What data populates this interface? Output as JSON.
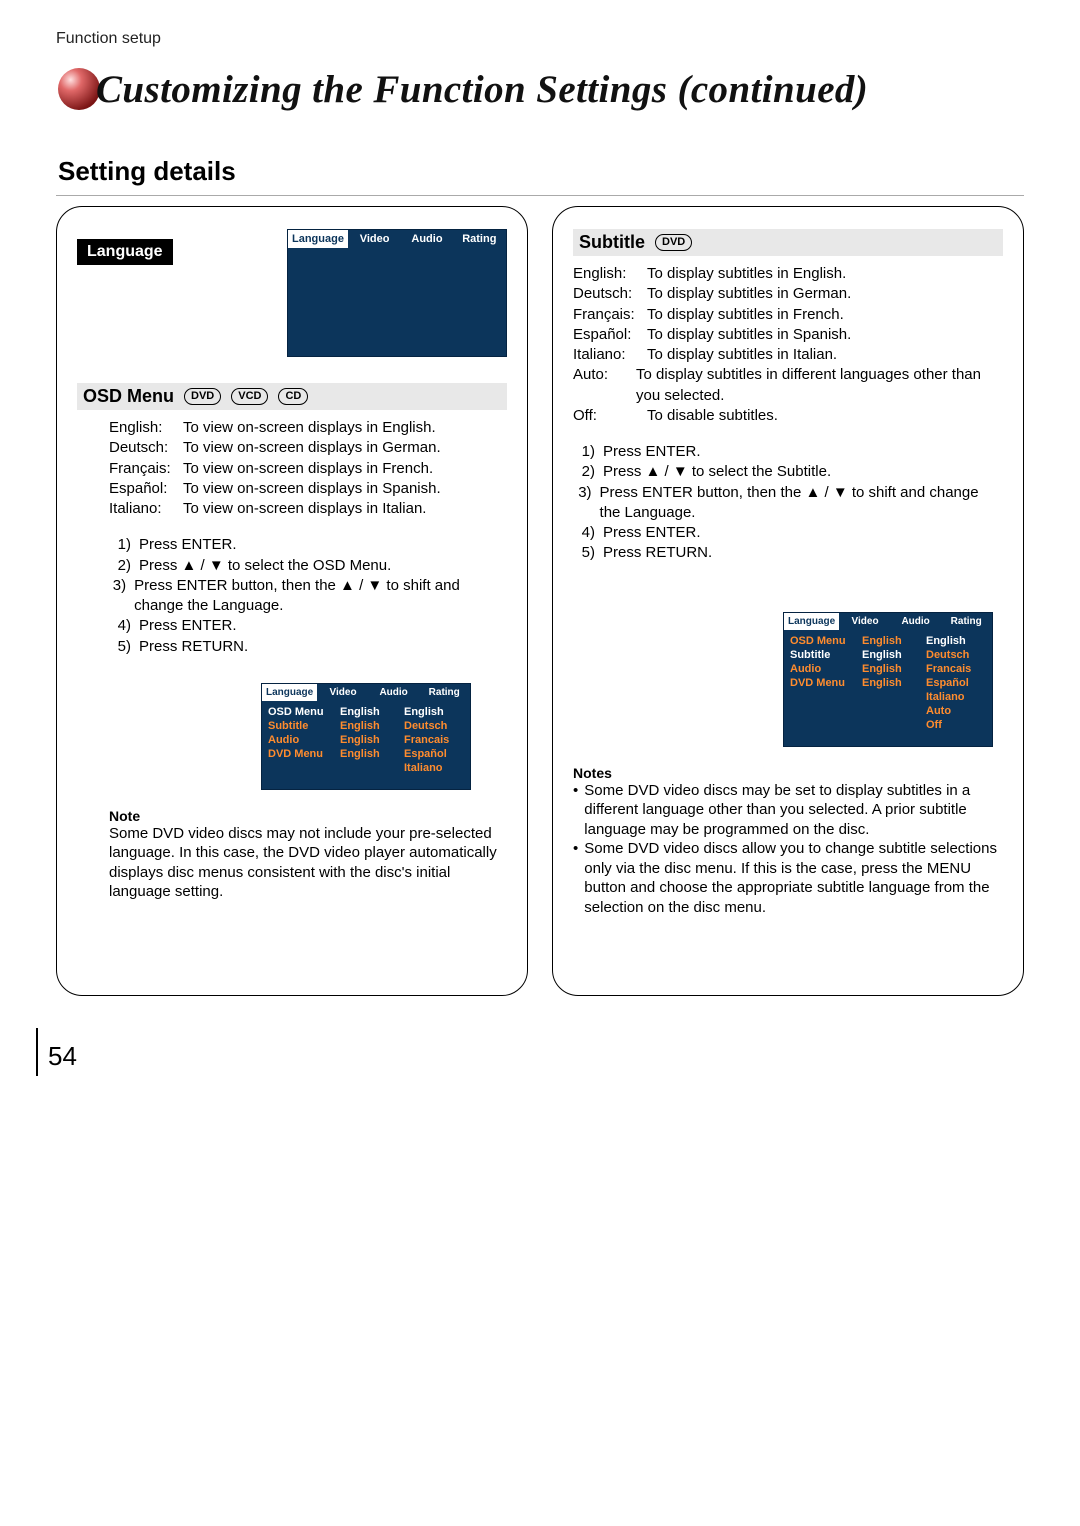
{
  "breadcrumb": "Function setup",
  "page_title": "Customizing the Function Settings (continued)",
  "section_heading": "Setting details",
  "tabs": {
    "language": "Language",
    "video": "Video",
    "audio": "Audio",
    "rating": "Rating"
  },
  "left": {
    "label": "Language",
    "osd_heading": "OSD Menu",
    "disc_badges": [
      "DVD",
      "VCD",
      "CD"
    ],
    "desc": [
      {
        "k": "English:",
        "v": "To view on-screen displays in English."
      },
      {
        "k": "Deutsch:",
        "v": "To view on-screen displays in German."
      },
      {
        "k": "Français:",
        "v": "To view on-screen displays in French."
      },
      {
        "k": "Español:",
        "v": "To view on-screen displays in Spanish."
      },
      {
        "k": "Italiano:",
        "v": "To view on-screen displays in Italian."
      }
    ],
    "steps": [
      "Press ENTER.",
      "Press ▲ / ▼ to select the OSD Menu.",
      "Press ENTER button, then the ▲ / ▼ to shift and change the Language.",
      "Press ENTER.",
      "Press RETURN."
    ],
    "mini_menu": {
      "rows": [
        {
          "c1": "OSD Menu",
          "c2": "English",
          "c3": "English"
        },
        {
          "c1": "Subtitle",
          "c2": "English",
          "c3": "Deutsch"
        },
        {
          "c1": "Audio",
          "c2": "English",
          "c3": "Francais"
        },
        {
          "c1": "DVD Menu",
          "c2": "English",
          "c3": "Español"
        },
        {
          "c1": "",
          "c2": "",
          "c3": "Italiano"
        }
      ]
    },
    "note_head": "Note",
    "note_body": "Some DVD video discs may not include your pre-selected language. In this case, the DVD video player automatically displays disc menus consistent with the disc's initial language setting."
  },
  "right": {
    "heading": "Subtitle",
    "disc_badges": [
      "DVD"
    ],
    "desc": [
      {
        "k": "English:",
        "v": "To display subtitles in English."
      },
      {
        "k": "Deutsch:",
        "v": "To display subtitles in German."
      },
      {
        "k": "Français:",
        "v": "To display subtitles in French."
      },
      {
        "k": "Español:",
        "v": "To display subtitles in Spanish."
      },
      {
        "k": "Italiano:",
        "v": "To display subtitles in Italian."
      },
      {
        "k": "Auto:",
        "v": "To display subtitles in different languages other than you selected."
      },
      {
        "k": "Off:",
        "v": "To disable subtitles."
      }
    ],
    "steps": [
      "Press ENTER.",
      "Press ▲ / ▼ to select the Subtitle.",
      "Press ENTER button, then the ▲ / ▼ to shift and change the Language.",
      "Press ENTER.",
      "Press RETURN."
    ],
    "mini_menu": {
      "rows": [
        {
          "c1": "OSD Menu",
          "c2": "English",
          "c3": "English"
        },
        {
          "c1": "Subtitle",
          "c2": "English",
          "c3": "Deutsch"
        },
        {
          "c1": "Audio",
          "c2": "English",
          "c3": "Francais"
        },
        {
          "c1": "DVD Menu",
          "c2": "English",
          "c3": "Español"
        },
        {
          "c1": "",
          "c2": "",
          "c3": "Italiano"
        },
        {
          "c1": "",
          "c2": "",
          "c3": "Auto"
        },
        {
          "c1": "",
          "c2": "",
          "c3": "Off"
        }
      ]
    },
    "note_head": "Notes",
    "notes": [
      "Some DVD video discs may be set to display subtitles in a different language other than you selected. A prior subtitle language may be programmed on the disc.",
      "Some DVD video discs allow you to change subtitle selections only via the disc menu. If this is the case, press the MENU button and choose the appropriate subtitle language from the selection on the disc menu."
    ]
  },
  "page_number": "54"
}
